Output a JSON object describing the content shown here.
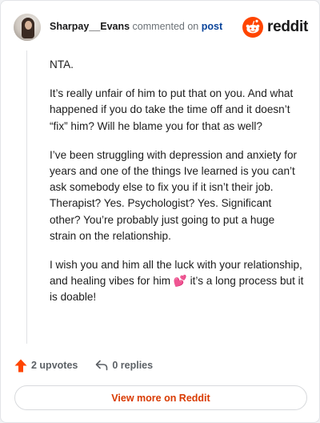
{
  "header": {
    "username": "Sharpay__Evans",
    "verb": "commented on",
    "post_link": "post",
    "brand": "reddit"
  },
  "comment": {
    "paragraphs": [
      "NTA.",
      "It’s really unfair of him to put that on you. And what happened if you do take the time off and it doesn’t “fix” him? Will he blame you for that as well?",
      "I’ve been struggling with depression and anxiety for years and one of the things Ive learned is you can’t ask somebody else to fix you if it isn’t their job. Therapist? Yes. Psychologist? Yes. Significant other? You’re probably just going to put a huge strain on the relationship."
    ],
    "last_paragraph_before": "I wish you and him all the luck with your relationship, and healing vibes for him ",
    "heart_emoji": "💕",
    "last_paragraph_after": " it’s a long process but it is doable!"
  },
  "actions": {
    "upvotes": "2 upvotes",
    "replies": "0 replies"
  },
  "footer": {
    "view_more": "View more on Reddit"
  },
  "colors": {
    "accent": "#d93a00",
    "reddit_orange": "#ff4500",
    "link": "#0a449b"
  }
}
